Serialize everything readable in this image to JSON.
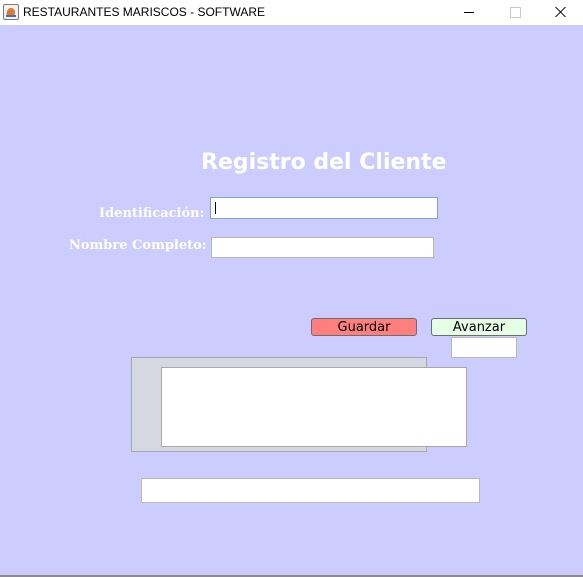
{
  "window": {
    "title": "RESTAURANTES MARISCOS - SOFTWARE",
    "icon": "java-icon"
  },
  "form": {
    "heading": "Registro del Cliente",
    "identificacion_label": "Identificación:",
    "identificacion_value": "",
    "nombre_label": "Nombre Completo:",
    "nombre_value": "",
    "small_field_value": "",
    "bottom_field_value": ""
  },
  "buttons": {
    "guardar": "Guardar",
    "avanzar": "Avanzar"
  },
  "colors": {
    "background": "#ccccff",
    "guardar": "#ff7f7f",
    "avanzar": "#e6fde6",
    "text": "#ffffff"
  }
}
